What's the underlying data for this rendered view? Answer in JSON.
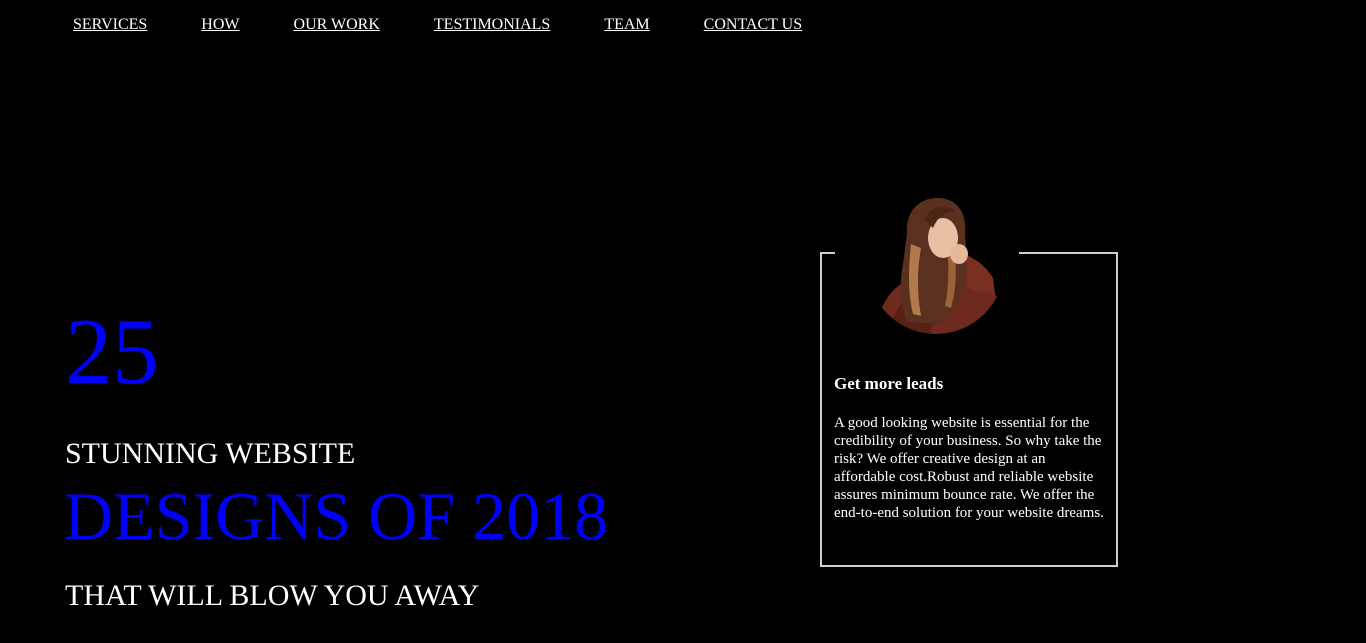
{
  "nav": {
    "items": [
      {
        "label": "SERVICES"
      },
      {
        "label": "HOW"
      },
      {
        "label": "OUR WORK"
      },
      {
        "label": "TESTIMONIALS"
      },
      {
        "label": "TEAM"
      },
      {
        "label": "CONTACT US"
      }
    ]
  },
  "hero": {
    "number": "25",
    "line1": "STUNNING WEBSITE",
    "line2": "DESIGNS OF 2018",
    "line3": "THAT WILL BLOW YOU AWAY"
  },
  "card": {
    "title": "Get more leads",
    "body": "A good looking website is essential for the credibility of your business. So why take the risk? We offer creative design at an affordable cost.Robust and reliable website assures minimum bounce rate. We offer the end-to-end solution for your website dreams."
  },
  "colors": {
    "background": "#000000",
    "accent": "#0000ff",
    "text": "#ffffff",
    "card_border": "#cfcfcf"
  }
}
